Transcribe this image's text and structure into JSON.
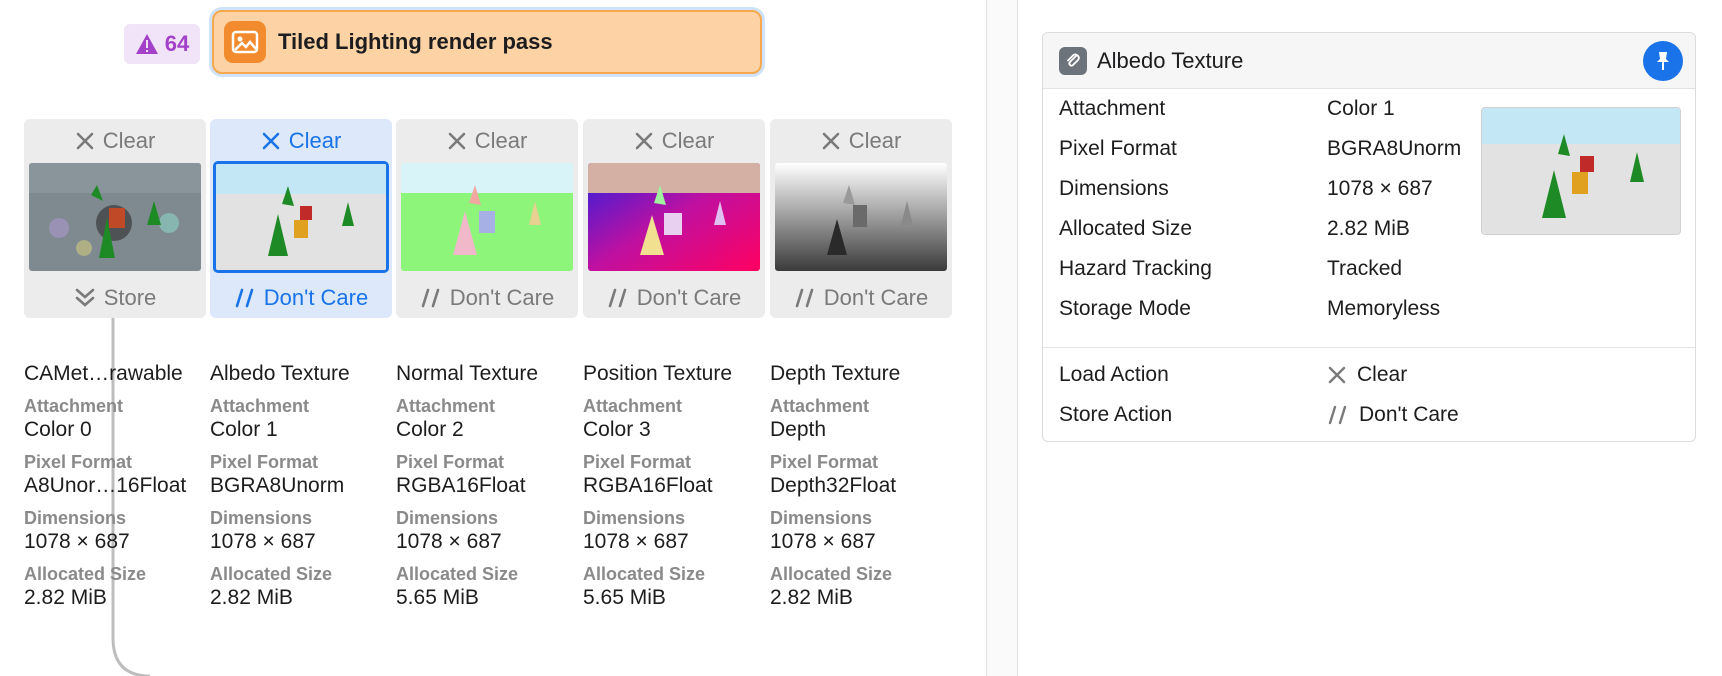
{
  "pass": {
    "warning_count": "64",
    "title": "Tiled Lighting render pass"
  },
  "attachments": [
    {
      "load": "Clear",
      "store": "Store",
      "name": "CAMet…rawable",
      "attachment": "Color 0",
      "pixel_format": "A8Unor…16Float",
      "dimensions": "1078 × 687",
      "allocated_size": "2.82 MiB"
    },
    {
      "load": "Clear",
      "store": "Don't Care",
      "name": "Albedo Texture",
      "attachment": "Color 1",
      "pixel_format": "BGRA8Unorm",
      "dimensions": "1078 × 687",
      "allocated_size": "2.82 MiB"
    },
    {
      "load": "Clear",
      "store": "Don't Care",
      "name": "Normal Texture",
      "attachment": "Color 2",
      "pixel_format": "RGBA16Float",
      "dimensions": "1078 × 687",
      "allocated_size": "5.65 MiB"
    },
    {
      "load": "Clear",
      "store": "Don't Care",
      "name": "Position Texture",
      "attachment": "Color 3",
      "pixel_format": "RGBA16Float",
      "dimensions": "1078 × 687",
      "allocated_size": "5.65 MiB"
    },
    {
      "load": "Clear",
      "store": "Don't Care",
      "name": "Depth Texture",
      "attachment": "Depth",
      "pixel_format": "Depth32Float",
      "dimensions": "1078 × 687",
      "allocated_size": "2.82 MiB"
    }
  ],
  "labels": {
    "attachment": "Attachment",
    "pixel_format": "Pixel Format",
    "dimensions": "Dimensions",
    "allocated_size": "Allocated Size"
  },
  "inspector": {
    "title": "Albedo Texture",
    "rows": [
      {
        "label": "Attachment",
        "value": "Color 1"
      },
      {
        "label": "Pixel Format",
        "value": "BGRA8Unorm"
      },
      {
        "label": "Dimensions",
        "value": "1078 × 687"
      },
      {
        "label": "Allocated Size",
        "value": "2.82 MiB"
      },
      {
        "label": "Hazard Tracking",
        "value": "Tracked"
      },
      {
        "label": "Storage Mode",
        "value": "Memoryless"
      }
    ],
    "actions": [
      {
        "label": "Load Action",
        "value": "Clear"
      },
      {
        "label": "Store Action",
        "value": "Don't Care"
      }
    ]
  },
  "colors": {
    "accent": "#1a73e8",
    "pass_fill": "#fdd3a6",
    "pass_border": "#f5a84c",
    "warning": "#a342c9"
  },
  "icons": {
    "clear": "x-mark-icon",
    "store": "double-chevron-down-icon",
    "dont_care": "double-slash-icon",
    "pass": "image-icon",
    "inspector": "paperclip-icon",
    "pin": "pin-icon",
    "warning": "warning-triangle-icon"
  }
}
